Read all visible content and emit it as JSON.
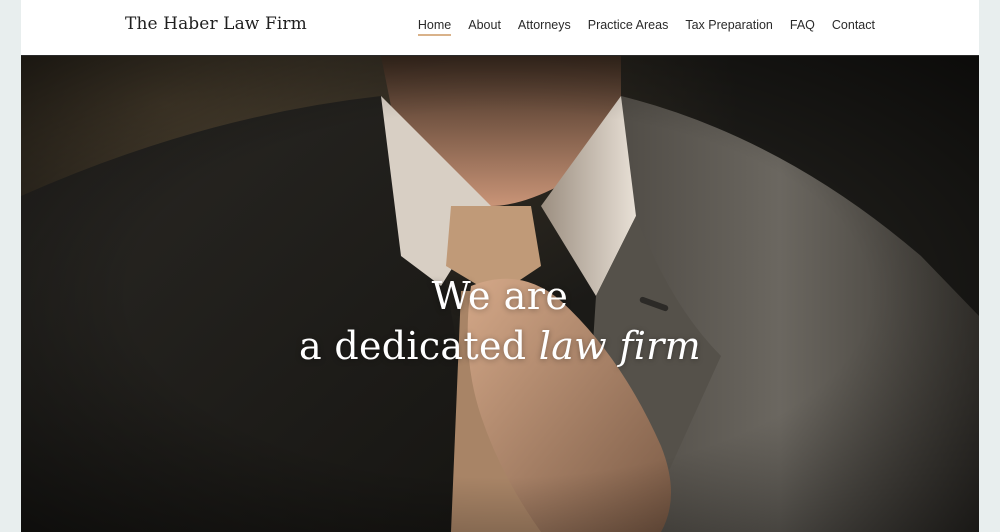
{
  "header": {
    "logo": "The Haber Law Firm",
    "nav": [
      {
        "label": "Home",
        "active": true
      },
      {
        "label": "About"
      },
      {
        "label": "Attorneys"
      },
      {
        "label": "Practice Areas"
      },
      {
        "label": "Tax Preparation"
      },
      {
        "label": "FAQ"
      },
      {
        "label": "Contact"
      }
    ]
  },
  "hero": {
    "image": "man-adjusting-tie-photo",
    "line1": "We are",
    "line2_plain": "a dedicated ",
    "line2_italic": "law firm"
  },
  "colors": {
    "accent_underline": "#d9b28a",
    "header_bg": "#ffffff",
    "page_bg": "#e8eeee"
  }
}
